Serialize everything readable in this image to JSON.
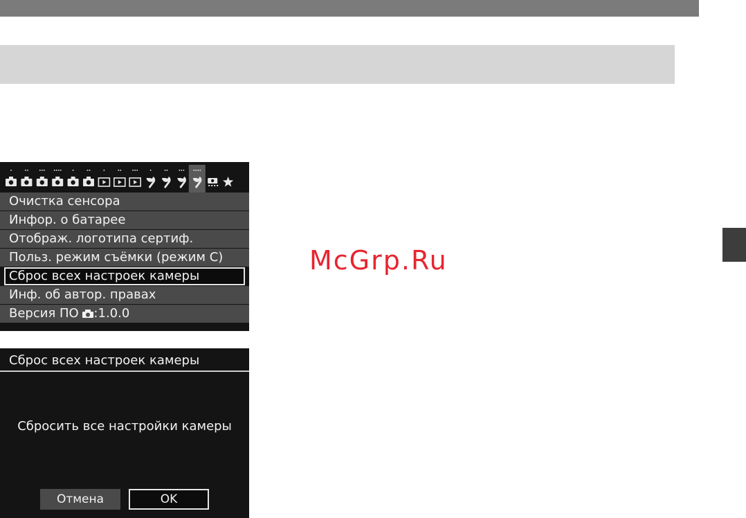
{
  "watermark": "McGrp.Ru",
  "colors": {
    "top_bar": "#7b7b7b",
    "section_bar": "#d6d6d6",
    "chapter_tab": "#3d3d3d",
    "screen_bg": "#141414",
    "menu_item_bg": "#4a4a4a",
    "watermark": "#e7252f"
  },
  "menu_screen": {
    "tabs": [
      {
        "icon": "camera-icon",
        "dots": 1
      },
      {
        "icon": "camera-icon",
        "dots": 2
      },
      {
        "icon": "camera-icon",
        "dots": 3
      },
      {
        "icon": "camera-icon",
        "dots": 4
      },
      {
        "icon": "camera-icon",
        "dots": 1
      },
      {
        "icon": "camera-icon",
        "dots": 2
      },
      {
        "icon": "playback-icon",
        "dots": 1
      },
      {
        "icon": "playback-icon",
        "dots": 2
      },
      {
        "icon": "playback-icon",
        "dots": 3
      },
      {
        "icon": "wrench-icon",
        "dots": 1
      },
      {
        "icon": "wrench-icon",
        "dots": 2
      },
      {
        "icon": "wrench-icon",
        "dots": 3
      },
      {
        "icon": "wrench-icon",
        "dots": 4,
        "active": true
      },
      {
        "icon": "custom-function-icon",
        "dots": 0
      },
      {
        "icon": "star-icon",
        "dots": 0
      }
    ],
    "items": [
      {
        "label": "Очистка сенсора"
      },
      {
        "label": "Инфор. о батарее"
      },
      {
        "label": "Отображ. логотипа сертиф."
      },
      {
        "label": "Польз. режим съёмки (режим С)"
      },
      {
        "label": "Сброс всех настроек камеры",
        "selected": true
      },
      {
        "label": "Инф. об автор. правах"
      },
      {
        "label_prefix": "Версия ПО ",
        "label_suffix": ":1.0.0"
      }
    ]
  },
  "dialog_screen": {
    "title": "Сброс всех настроек камеры",
    "message": "Сбросить все настройки камеры",
    "cancel_label": "Отмена",
    "ok_label": "OK"
  }
}
